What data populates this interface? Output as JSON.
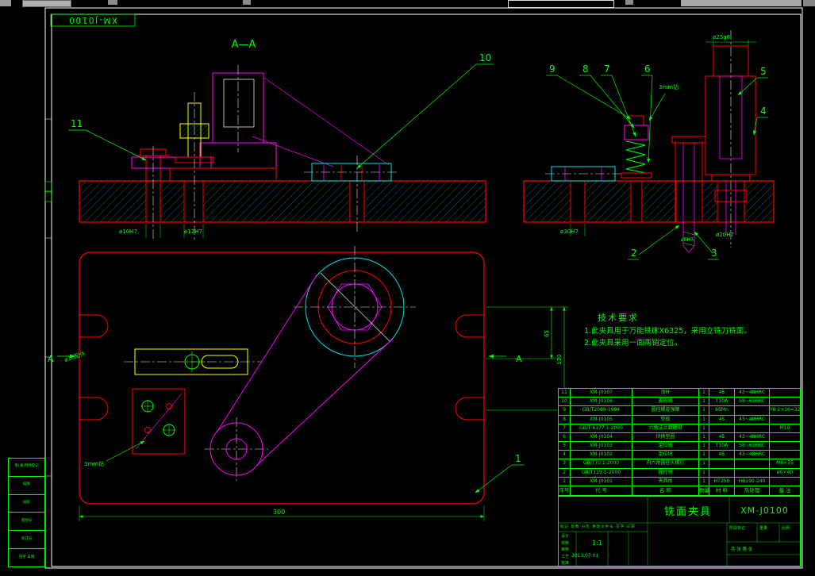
{
  "sheet_tag": "XM-J0100",
  "front_view": {
    "section_title": "A—A"
  },
  "callouts": {
    "c1": "1",
    "c2": "2",
    "c3": "3",
    "c4": "4",
    "c5": "5",
    "c6": "6",
    "c7": "7",
    "c8": "8",
    "c9": "9",
    "c10": "10",
    "c11": "11"
  },
  "dims": {
    "phi10": "ø10H7",
    "phi12": "ø12H7",
    "phi30": "ø30H7",
    "phi20": "ø20H7",
    "phi6": "ø6H7",
    "phi25": "ø25g6",
    "len300": "300",
    "len130": "130",
    "len65": "65",
    "phi16": "ø16配作",
    "drill_a": "3mm钻",
    "drill_b": "3mm钻",
    "sec_a_left": "A",
    "sec_a_right": "A"
  },
  "tech": {
    "title": "技术要求",
    "l1": "1.此夹具用于万能铣床X6325，采用立铣刀铣面。",
    "l2": "2.此夹具采用一面两销定位。"
  },
  "bom": {
    "headers": [
      "序号",
      "代  号",
      "名  称",
      "数量",
      "材 料",
      "热处理",
      "备 注"
    ],
    "rows": [
      [
        "11",
        "XM-J0107",
        "顶杆",
        "1",
        "45",
        "43~48HRC",
        ""
      ],
      [
        "10",
        "XM-J0106",
        "菱形销",
        "1",
        "T10A",
        "58~63HRC",
        ""
      ],
      [
        "9",
        "GB/T2089-1994",
        "圆柱螺旋弹簧",
        "1",
        "65Mn",
        "",
        "Y8 2×16=32"
      ],
      [
        "8",
        "XM-J0105",
        "垫板",
        "1",
        "45",
        "43~48HRC",
        ""
      ],
      [
        "7",
        "GB/T 6177.1-2000",
        "六角法兰面螺母",
        "1",
        "",
        "",
        "M10"
      ],
      [
        "6",
        "XM-J0104",
        "快换垫圈",
        "1",
        "45",
        "43~48HRC",
        ""
      ],
      [
        "5",
        "XM-J0103",
        "定位销",
        "1",
        "T10A",
        "58~63HRC",
        ""
      ],
      [
        "4",
        "XM-J0102",
        "定位块",
        "1",
        "45",
        "43~48HRC",
        ""
      ],
      [
        "3",
        "GB/T70.1-2000",
        "内六角圆柱头螺钉",
        "1",
        "",
        "",
        "M6×35"
      ],
      [
        "2",
        "GB/T119.1-2000",
        "圆柱销",
        "1",
        "",
        "",
        "ø6×40"
      ],
      [
        "1",
        "XM-J0101",
        "夹具体",
        "1",
        "HT250",
        "HB190-240",
        ""
      ]
    ]
  },
  "titleblock": {
    "title": "铣面夹具",
    "code": "XM-J0100",
    "scale": "1:1",
    "date": "2013.07.01",
    "header_row": "标记 处数 分区 更改文件号 签字 日期",
    "roles": [
      "设计",
      "校核",
      "审核",
      "工艺",
      "批准"
    ],
    "stage": "阶段标记",
    "weight": "重量",
    "ratio": "比例",
    "sheets": "共 张  第 张"
  },
  "margin_block": {
    "rows": [
      "借(通)用件登记",
      "描图",
      "描校",
      "底图号",
      "装订号",
      "签字  日期"
    ]
  }
}
